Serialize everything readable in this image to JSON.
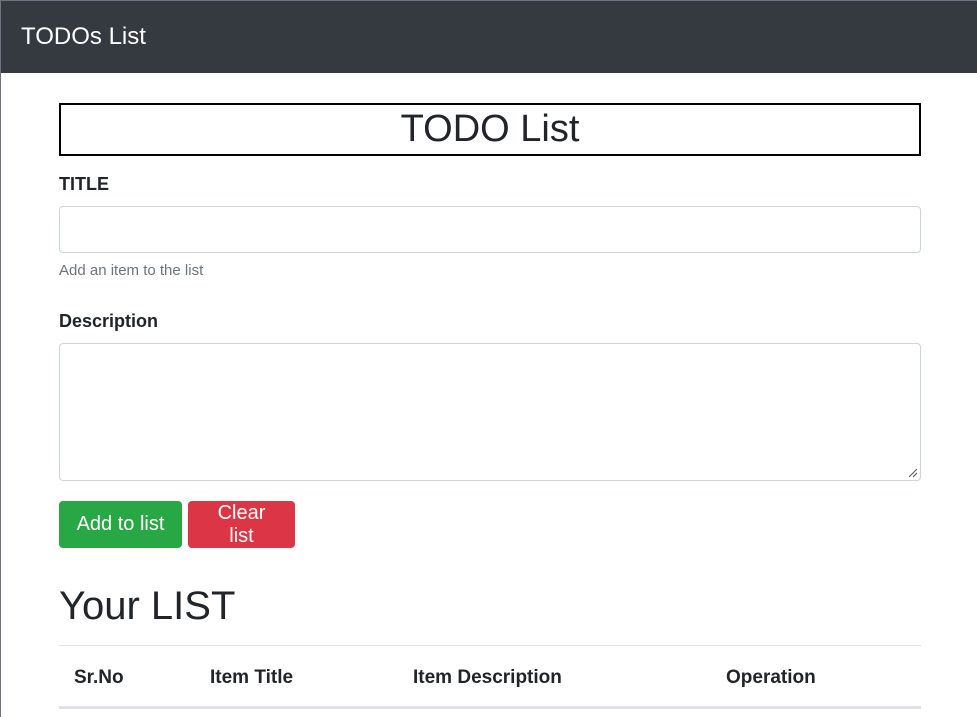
{
  "navbar": {
    "brand": "TODOs List"
  },
  "form": {
    "heading": "TODO List",
    "title_label": "TITLE",
    "title_value": "",
    "title_help": "Add an item to the list",
    "description_label": "Description",
    "description_value": "",
    "add_button": "Add to list",
    "clear_button": "Clear list"
  },
  "list": {
    "heading": "Your LIST",
    "columns": [
      "Sr.No",
      "Item Title",
      "Item Description",
      "Operation"
    ]
  },
  "colors": {
    "navbar_bg": "#343a40",
    "success": "#28a745",
    "danger": "#dc3545"
  }
}
